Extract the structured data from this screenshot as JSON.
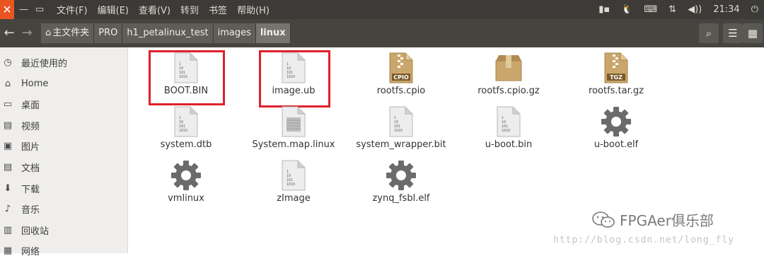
{
  "window": {
    "close_glyph": "✕",
    "minimize_glyph": "—",
    "maximize_glyph": "▭"
  },
  "menu": [
    "文件(F)",
    "编辑(E)",
    "查看(V)",
    "转到",
    "书签",
    "帮助(H)"
  ],
  "tray": {
    "battery_glyph": "▮▪",
    "sound_glyph": "◀))",
    "clock": "21:34",
    "power_glyph": "⏻"
  },
  "nav": {
    "back_glyph": "←",
    "forward_glyph": "→"
  },
  "breadcrumb": [
    {
      "label": "主文件夹",
      "icon": "home-icon"
    },
    {
      "label": "PRO"
    },
    {
      "label": "h1_petalinux_test"
    },
    {
      "label": "images"
    },
    {
      "label": "linux",
      "active": true
    }
  ],
  "toolbar": {
    "search_glyph": "⌕",
    "list_glyph": "☰",
    "grid_glyph": "▦"
  },
  "sidebar": [
    {
      "label": "最近使用的",
      "icon": "clock-icon",
      "glyph": "◷"
    },
    {
      "label": "Home",
      "icon": "home-icon",
      "glyph": "⌂"
    },
    {
      "label": "桌面",
      "icon": "desktop-icon",
      "glyph": "▭"
    },
    {
      "label": "视频",
      "icon": "video-icon",
      "glyph": "▤"
    },
    {
      "label": "图片",
      "icon": "picture-icon",
      "glyph": "▣"
    },
    {
      "label": "文档",
      "icon": "document-icon",
      "glyph": "▤"
    },
    {
      "label": "下载",
      "icon": "download-icon",
      "glyph": "⬇"
    },
    {
      "label": "音乐",
      "icon": "music-icon",
      "glyph": "♪"
    },
    {
      "label": "回收站",
      "icon": "trash-icon",
      "glyph": "▥"
    },
    {
      "label": "网络",
      "icon": "network-icon",
      "glyph": "▦"
    }
  ],
  "files": [
    {
      "name": "BOOT.BIN",
      "type": "binary",
      "highlighted": true
    },
    {
      "name": "image.ub",
      "type": "binary",
      "highlighted": true
    },
    {
      "name": "rootfs.cpio",
      "type": "archive",
      "tag": "CPIO"
    },
    {
      "name": "rootfs.cpio.gz",
      "type": "package"
    },
    {
      "name": "rootfs.tar.gz",
      "type": "archive",
      "tag": "TGZ"
    },
    {
      "name": "system.dtb",
      "type": "binary"
    },
    {
      "name": "System.map.linux",
      "type": "text"
    },
    {
      "name": "system_wrapper.bit",
      "type": "binary"
    },
    {
      "name": "u-boot.bin",
      "type": "binary"
    },
    {
      "name": "u-boot.elf",
      "type": "executable"
    },
    {
      "name": "vmlinux",
      "type": "executable"
    },
    {
      "name": "zImage",
      "type": "binary"
    },
    {
      "name": "zynq_fsbl.elf",
      "type": "executable"
    }
  ],
  "watermark": {
    "label": "FPGAer俱乐部",
    "url": "http://blog.csdn.net/long_fly"
  },
  "colors": {
    "accent": "#e95420",
    "highlight_box": "#e0202a",
    "archive": "#c9a66b",
    "gear": "#6b6b6b"
  }
}
